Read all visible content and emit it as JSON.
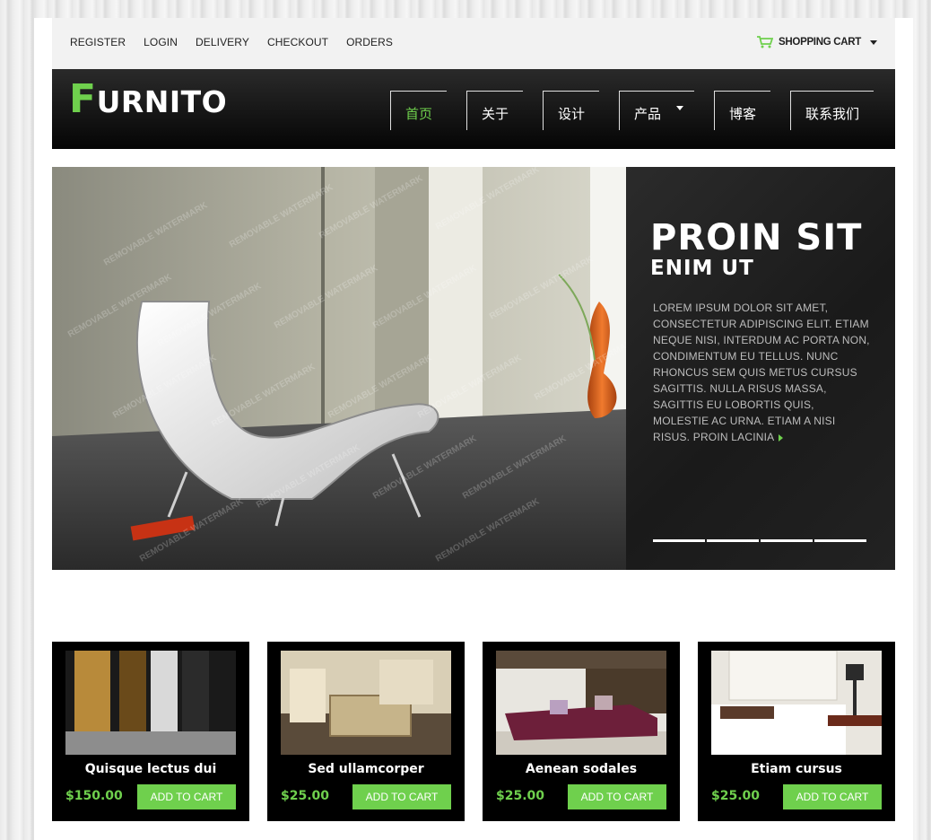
{
  "topbar": {
    "links": [
      "REGISTER",
      "LOGIN",
      "DELIVERY",
      "CHECKOUT",
      "ORDERS"
    ],
    "cart_label": "SHOPPING CART"
  },
  "header": {
    "logo_first": "F",
    "logo_rest": "URNITO",
    "nav": [
      "首页",
      "关于",
      "设计",
      "产品",
      "博客",
      "联系我们"
    ],
    "active_nav": "首页"
  },
  "hero": {
    "title": "PROIN SIT",
    "subtitle": "ENIM UT",
    "text": "LOREM IPSUM DOLOR SIT AMET, CONSECTETUR ADIPISCING ELIT. ETIAM NEQUE NISI, INTERDUM AC PORTA NON, CONDIMENTUM EU TELLUS. NUNC RHONCUS SEM QUIS METUS CURSUS SAGITTIS. NULLA RISUS MASSA, SAGITTIS EU LOBORTIS QUIS, MOLESTIE AC URNA. ETIAM A NISI RISUS. PROIN LACINIA",
    "slide_count": 4,
    "watermark": "REMOVABLE WATERMARK"
  },
  "products": [
    {
      "name": "Quisque lectus dui",
      "price": "$150.00",
      "button": "ADD TO CART",
      "image": "decorative-wall-panels"
    },
    {
      "name": "Sed ullamcorper",
      "price": "$25.00",
      "button": "ADD TO CART",
      "image": "baby-crib-room"
    },
    {
      "name": "Aenean sodales",
      "price": "$25.00",
      "button": "ADD TO CART",
      "image": "purple-sofa"
    },
    {
      "name": "Etiam cursus",
      "price": "$25.00",
      "button": "ADD TO CART",
      "image": "tufted-bed"
    }
  ],
  "colors": {
    "accent": "#6fd04d",
    "header_bg": "#111111",
    "topbar_bg": "#f2f2f2"
  }
}
